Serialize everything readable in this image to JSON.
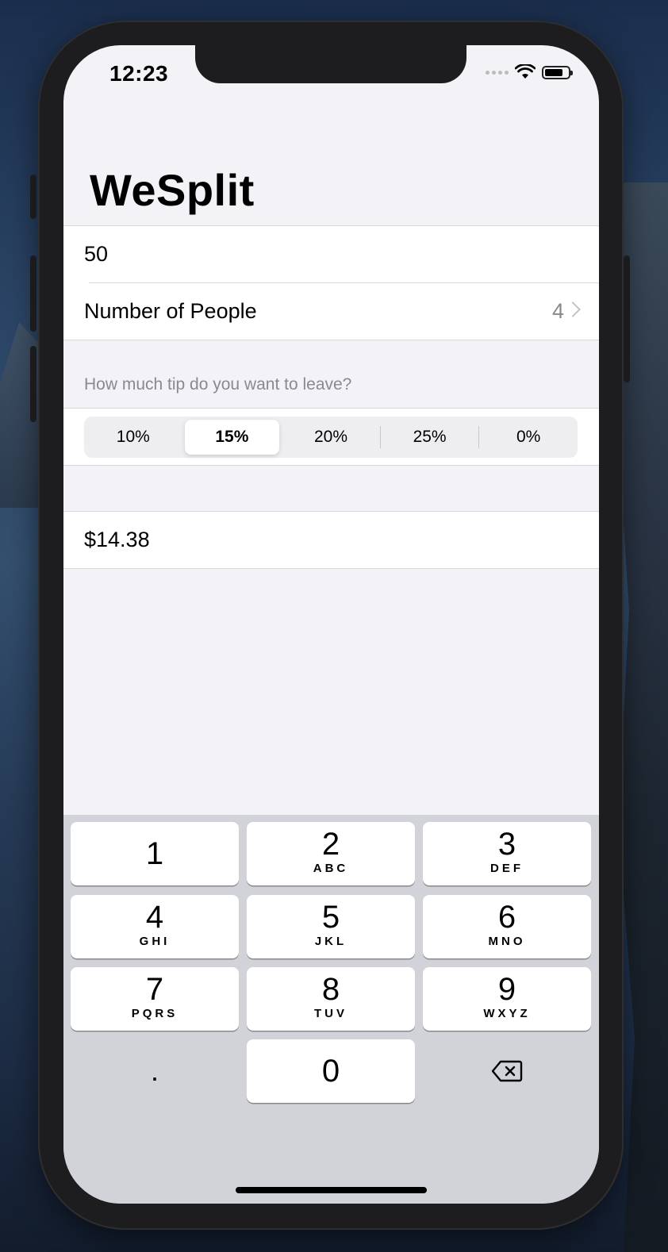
{
  "status_bar": {
    "time": "12:23"
  },
  "app": {
    "title": "WeSplit"
  },
  "form": {
    "amount_value": "50",
    "people_label": "Number of People",
    "people_value": "4"
  },
  "tip": {
    "header": "How much tip do you want to leave?",
    "options": [
      "10%",
      "15%",
      "20%",
      "25%",
      "0%"
    ],
    "selected": "15%"
  },
  "result": {
    "total_per_person": "$14.38"
  },
  "keypad": {
    "keys": [
      {
        "digit": "1",
        "letters": ""
      },
      {
        "digit": "2",
        "letters": "ABC"
      },
      {
        "digit": "3",
        "letters": "DEF"
      },
      {
        "digit": "4",
        "letters": "GHI"
      },
      {
        "digit": "5",
        "letters": "JKL"
      },
      {
        "digit": "6",
        "letters": "MNO"
      },
      {
        "digit": "7",
        "letters": "PQRS"
      },
      {
        "digit": "8",
        "letters": "TUV"
      },
      {
        "digit": "9",
        "letters": "WXYZ"
      },
      {
        "digit": ".",
        "letters": ""
      },
      {
        "digit": "0",
        "letters": ""
      },
      {
        "digit": "",
        "letters": ""
      }
    ],
    "delete_icon": "delete-backward-icon"
  },
  "colors": {
    "background": "#f2f2f7",
    "keyboard": "#d1d3d9",
    "secondary_text": "#8a8a8e"
  }
}
